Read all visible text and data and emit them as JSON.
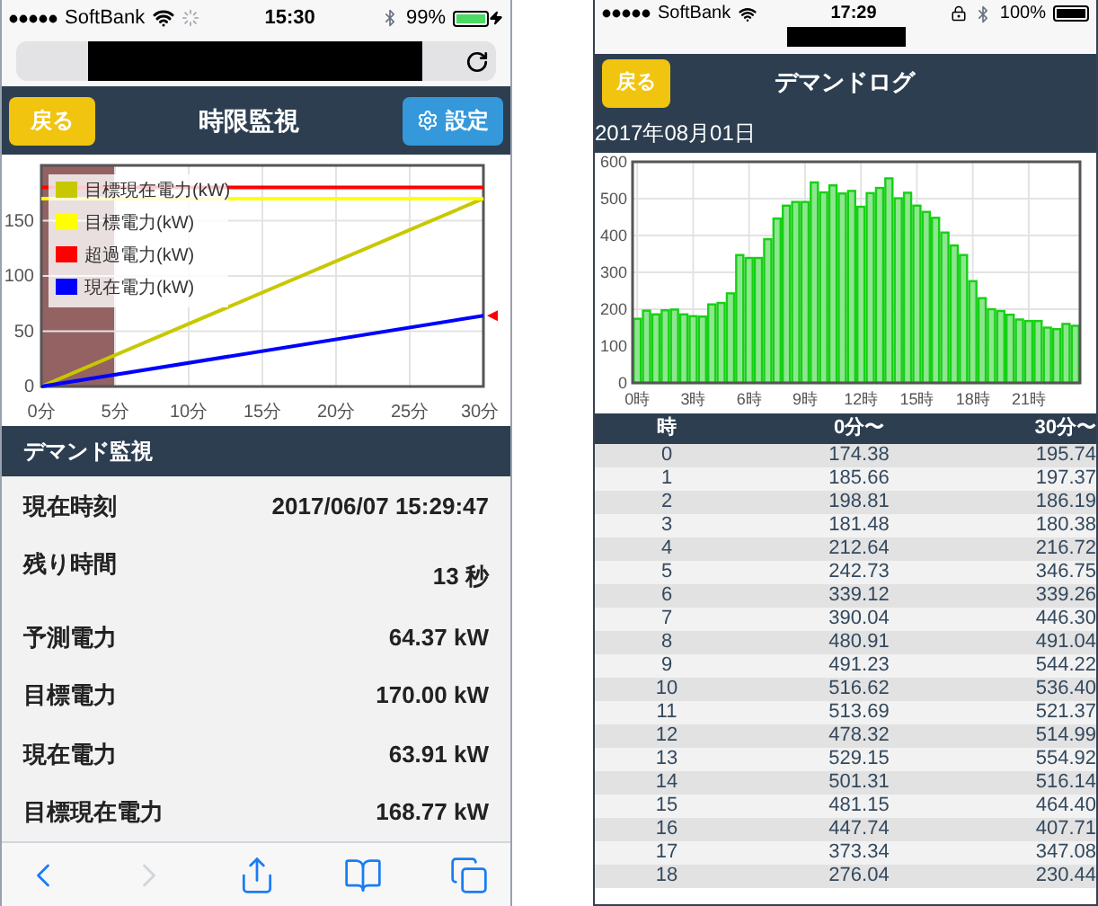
{
  "left_screen": {
    "status_bar": {
      "carrier": "SoftBank",
      "time": "15:30",
      "battery": "99%",
      "battery_charging": true
    },
    "header": {
      "back_button": "戻る",
      "title": "時限監視",
      "settings_button": "設定"
    },
    "chart": {
      "chart_data": {
        "type": "line",
        "x": [
          0,
          30
        ],
        "xlim": [
          0,
          30
        ],
        "ylim": [
          0,
          200
        ],
        "grid": true,
        "legend": true,
        "xticks": [
          {
            "value": 0,
            "label": "0分"
          },
          {
            "value": 5,
            "label": "5分"
          },
          {
            "value": 10,
            "label": "10分"
          },
          {
            "value": 15,
            "label": "15分"
          },
          {
            "value": 20,
            "label": "20分"
          },
          {
            "value": 25,
            "label": "25分"
          },
          {
            "value": 30,
            "label": "30分"
          }
        ],
        "yticks": [
          0,
          50,
          100,
          150
        ],
        "series": [
          {
            "name": "目標現在電力(kW)",
            "color": "#c8c800",
            "values": [
              0,
              170
            ]
          },
          {
            "name": "目標電力(kW)",
            "color": "#ffff00",
            "values": [
              170,
              170
            ]
          },
          {
            "name": "超過電力(kW)",
            "color": "#ff0000",
            "values": [
              180,
              180
            ]
          },
          {
            "name": "現在電力(kW)",
            "color": "#0000ff",
            "values": [
              0,
              64
            ]
          }
        ],
        "bands": [
          {
            "axis": "x",
            "from": 0,
            "to": 5,
            "color": "#946262"
          }
        ]
      }
    },
    "section": {
      "title": "デマンド監視",
      "rows": [
        {
          "label": "現在時刻",
          "value": "2017/06/07 15:29:47"
        },
        {
          "label": "残り時間",
          "value": "13 秒"
        },
        {
          "label": "予測電力",
          "value": "64.37 kW"
        },
        {
          "label": "目標電力",
          "value": "170.00 kW"
        },
        {
          "label": "現在電力",
          "value": "63.91 kW"
        },
        {
          "label": "目標現在電力",
          "value": "168.77 kW"
        }
      ]
    },
    "toolbar": [
      {
        "kind": "back",
        "disabled": false
      },
      {
        "kind": "forward",
        "disabled": true
      },
      {
        "kind": "share",
        "disabled": false
      },
      {
        "kind": "bookmarks",
        "disabled": false
      },
      {
        "kind": "tabs",
        "disabled": false
      }
    ]
  },
  "right_screen": {
    "status_bar": {
      "carrier": "SoftBank",
      "time": "17:29",
      "battery": "100%",
      "battery_charging": false
    },
    "header": {
      "back_button": "戻る",
      "title": "デマンドログ"
    },
    "date": "2017年08月01日",
    "chart": {
      "chart_data": {
        "type": "bar",
        "xlim": [
          -0.25,
          23.75
        ],
        "ylim": [
          0,
          600
        ],
        "grid": true,
        "x": [
          0,
          0.5,
          1,
          1.5,
          2,
          2.5,
          3,
          3.5,
          4,
          4.5,
          5,
          5.5,
          6,
          6.5,
          7,
          7.5,
          8,
          8.5,
          9,
          9.5,
          10,
          10.5,
          11,
          11.5,
          12,
          12.5,
          13,
          13.5,
          14,
          14.5,
          15,
          15.5,
          16,
          16.5,
          17,
          17.5,
          18,
          18.5,
          19,
          19.5,
          20,
          20.5,
          21,
          21.5,
          22,
          22.5,
          23,
          23.5
        ],
        "values": [
          174,
          196,
          186,
          197,
          199,
          186,
          181,
          180,
          213,
          217,
          243,
          347,
          339,
          339,
          390,
          446,
          481,
          491,
          491,
          544,
          517,
          536,
          514,
          521,
          478,
          515,
          529,
          555,
          501,
          516,
          481,
          464,
          448,
          408,
          373,
          347,
          276,
          230,
          200,
          195,
          185,
          172,
          168,
          168,
          150,
          146,
          160,
          155
        ],
        "yticks": [
          0,
          100,
          200,
          300,
          400,
          500,
          600
        ],
        "xticks": [
          {
            "value": 0,
            "label": "0時"
          },
          {
            "value": 3,
            "label": "3時"
          },
          {
            "value": 6,
            "label": "6時"
          },
          {
            "value": 9,
            "label": "9時"
          },
          {
            "value": 12,
            "label": "12時"
          },
          {
            "value": 15,
            "label": "15時"
          },
          {
            "value": 18,
            "label": "18時"
          },
          {
            "value": 21,
            "label": "21時"
          }
        ]
      }
    },
    "table": {
      "columns": [
        "時",
        "0分〜",
        "30分〜"
      ],
      "rows": [
        [
          "0",
          "174.38",
          "195.74"
        ],
        [
          "1",
          "185.66",
          "197.37"
        ],
        [
          "2",
          "198.81",
          "186.19"
        ],
        [
          "3",
          "181.48",
          "180.38"
        ],
        [
          "4",
          "212.64",
          "216.72"
        ],
        [
          "5",
          "242.73",
          "346.75"
        ],
        [
          "6",
          "339.12",
          "339.26"
        ],
        [
          "7",
          "390.04",
          "446.30"
        ],
        [
          "8",
          "480.91",
          "491.04"
        ],
        [
          "9",
          "491.23",
          "544.22"
        ],
        [
          "10",
          "516.62",
          "536.40"
        ],
        [
          "11",
          "513.69",
          "521.37"
        ],
        [
          "12",
          "478.32",
          "514.99"
        ],
        [
          "13",
          "529.15",
          "554.92"
        ],
        [
          "14",
          "501.31",
          "516.14"
        ],
        [
          "15",
          "481.15",
          "464.40"
        ],
        [
          "16",
          "447.74",
          "407.71"
        ],
        [
          "17",
          "373.34",
          "347.08"
        ],
        [
          "18",
          "276.04",
          "230.44"
        ]
      ]
    }
  }
}
